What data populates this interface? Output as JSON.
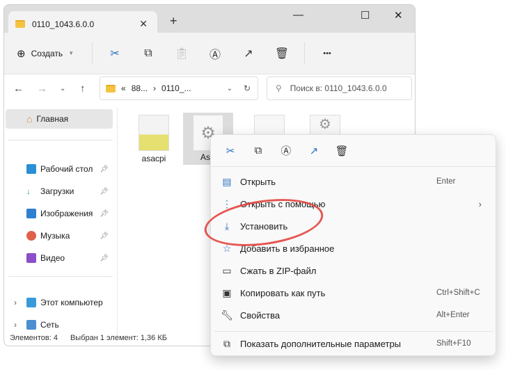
{
  "window": {
    "tab_title": "0110_1043.6.0.0",
    "new_tab": "+",
    "close_tab": "✕",
    "minimize": "—",
    "maximize": "☐",
    "close": "✕"
  },
  "toolbar": {
    "create_label": "Создать",
    "more": "•••"
  },
  "nav": {
    "breadcrumb_prefix": "«",
    "crumb1": "88...",
    "sep": "›",
    "crumb2": "0110_...",
    "search_placeholder": "Поиск в: 0110_1043.6.0.0"
  },
  "sidebar": {
    "items": [
      {
        "label": "Главная"
      },
      {
        "label": "Рабочий стол"
      },
      {
        "label": "Загрузки"
      },
      {
        "label": "Изображения"
      },
      {
        "label": "Музыка"
      },
      {
        "label": "Видео"
      },
      {
        "label": "Этот компьютер"
      },
      {
        "label": "Сеть"
      }
    ]
  },
  "files": [
    {
      "name": "asacpi"
    },
    {
      "name": "AsA"
    }
  ],
  "status": {
    "count": "Элементов: 4",
    "selected": "Выбран 1 элемент: 1,36 КБ"
  },
  "context_menu": {
    "items": [
      {
        "label": "Открыть",
        "shortcut": "Enter"
      },
      {
        "label": "Открыть с помощью",
        "shortcut": ""
      },
      {
        "label": "Установить",
        "shortcut": ""
      },
      {
        "label": "Добавить в избранное",
        "shortcut": ""
      },
      {
        "label": "Сжать в ZIP-файл",
        "shortcut": ""
      },
      {
        "label": "Копировать как путь",
        "shortcut": "Ctrl+Shift+C"
      },
      {
        "label": "Свойства",
        "shortcut": "Alt+Enter"
      },
      {
        "label": "Показать дополнительные параметры",
        "shortcut": "Shift+F10"
      }
    ]
  },
  "colors": {
    "accent": "#2a6fc0",
    "highlight": "#e2453e"
  }
}
